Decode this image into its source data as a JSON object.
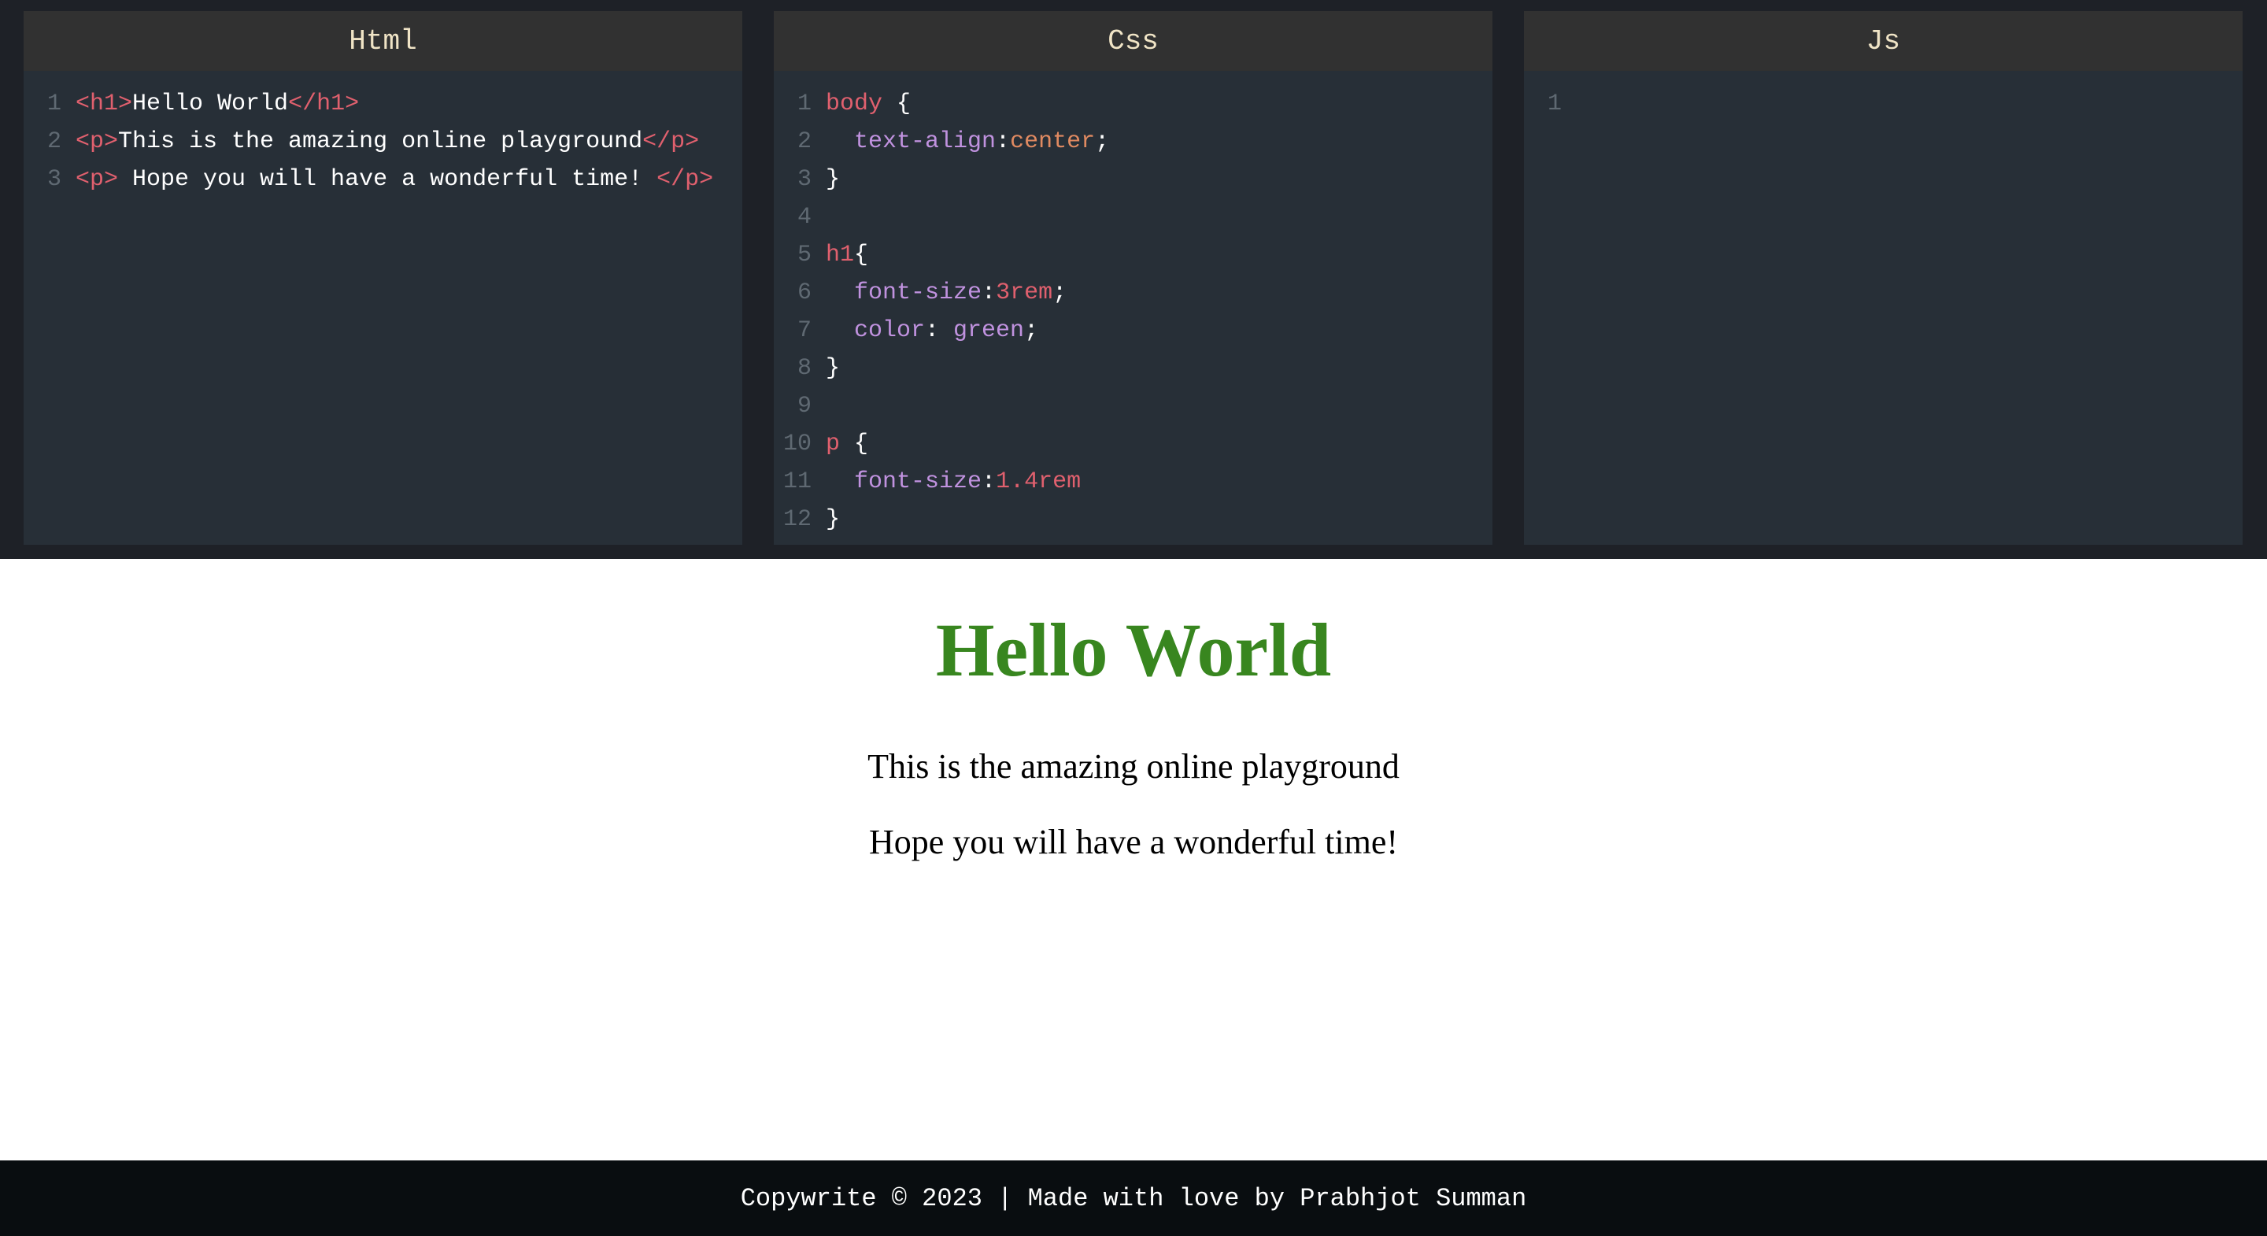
{
  "editors": {
    "html": {
      "title": "Html",
      "lines": [
        {
          "n": "1",
          "parts": [
            [
              "tag",
              "<h1>"
            ],
            [
              "txt",
              "Hello World"
            ],
            [
              "tag",
              "</h1>"
            ]
          ]
        },
        {
          "n": "2",
          "parts": [
            [
              "tag",
              "<p>"
            ],
            [
              "txt",
              "This is the amazing online playground"
            ],
            [
              "tag",
              "</p>"
            ]
          ]
        },
        {
          "n": "3",
          "parts": [
            [
              "tag",
              "<p>"
            ],
            [
              "txt",
              " Hope you will have a wonderful time! "
            ],
            [
              "tag",
              "</p>"
            ]
          ]
        }
      ]
    },
    "css": {
      "title": "Css",
      "lines": [
        {
          "n": "1",
          "parts": [
            [
              "sel",
              "body"
            ],
            [
              "punc",
              " {"
            ]
          ]
        },
        {
          "n": "2",
          "parts": [
            [
              "punc",
              "  "
            ],
            [
              "prop",
              "text-align"
            ],
            [
              "punc",
              ":"
            ],
            [
              "val",
              "center"
            ],
            [
              "punc",
              ";"
            ]
          ]
        },
        {
          "n": "3",
          "parts": [
            [
              "punc",
              "}"
            ]
          ]
        },
        {
          "n": "4",
          "parts": []
        },
        {
          "n": "5",
          "parts": [
            [
              "sel",
              "h1"
            ],
            [
              "punc",
              "{"
            ]
          ]
        },
        {
          "n": "6",
          "parts": [
            [
              "punc",
              "  "
            ],
            [
              "prop",
              "font-size"
            ],
            [
              "punc",
              ":"
            ],
            [
              "num",
              "3rem"
            ],
            [
              "punc",
              ";"
            ]
          ]
        },
        {
          "n": "7",
          "parts": [
            [
              "punc",
              "  "
            ],
            [
              "prop",
              "color"
            ],
            [
              "punc",
              ": "
            ],
            [
              "kw",
              "green"
            ],
            [
              "punc",
              ";"
            ]
          ]
        },
        {
          "n": "8",
          "parts": [
            [
              "punc",
              "}"
            ]
          ]
        },
        {
          "n": "9",
          "parts": []
        },
        {
          "n": "10",
          "parts": [
            [
              "sel",
              "p"
            ],
            [
              "punc",
              " {"
            ]
          ]
        },
        {
          "n": "11",
          "parts": [
            [
              "punc",
              "  "
            ],
            [
              "prop",
              "font-size"
            ],
            [
              "punc",
              ":"
            ],
            [
              "num",
              "1.4rem"
            ]
          ]
        },
        {
          "n": "12",
          "parts": [
            [
              "punc",
              "}"
            ]
          ]
        }
      ]
    },
    "js": {
      "title": "Js",
      "lines": [
        {
          "n": "1",
          "parts": []
        }
      ]
    }
  },
  "preview": {
    "heading": "Hello World",
    "paragraph_1": "This is the amazing online playground",
    "paragraph_2": "Hope you will have a wonderful time!"
  },
  "footer": {
    "text": "Copywrite © 2023 | Made with love by Prabhjot Summan"
  },
  "colors": {
    "editor_bg": "#1e2127",
    "pane_bg": "#272f37",
    "header_bg": "#313131",
    "heading_green": "#38861f",
    "tag_red": "#e0606e",
    "property_purple": "#c092df",
    "value_orange": "#e08a61",
    "footer_bg": "#090d10"
  }
}
